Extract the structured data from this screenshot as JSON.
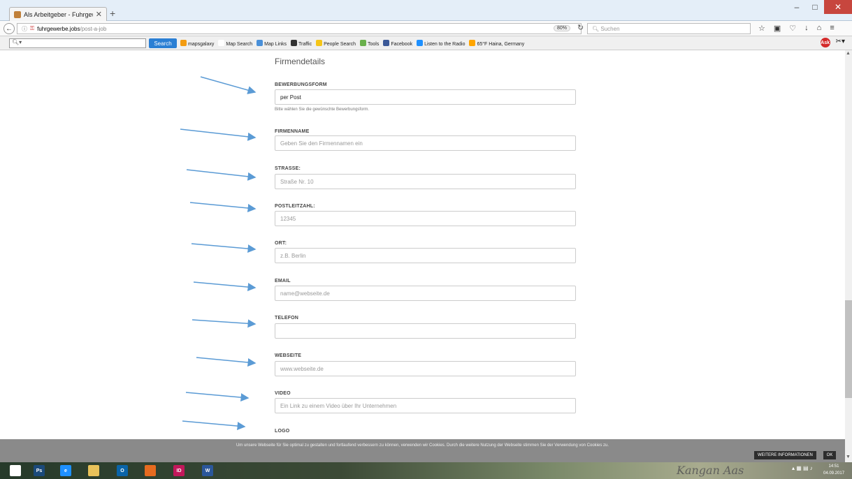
{
  "browser": {
    "tab_title": "Als Arbeitgeber - Fuhrgewer",
    "tab_close": "✕",
    "new_tab": "+",
    "url_host": "fuhrgewerbe.jobs",
    "url_path": "/post-a-job",
    "zoom": "80%",
    "search_placeholder": "Suchen",
    "window_minimize": "–",
    "window_maximize": "□",
    "window_close": "✕"
  },
  "toolbar": {
    "search_button": "Search",
    "items": [
      {
        "label": "mapsgalaxy",
        "color": "#f39c12"
      },
      {
        "label": "Map Search",
        "color": "#ffffff"
      },
      {
        "label": "Map Links",
        "color": "#4a90d9"
      },
      {
        "label": "Traffic",
        "color": "#333333"
      },
      {
        "label": "People Search",
        "color": "#f5c518"
      },
      {
        "label": "Tools",
        "color": "#6ab04c"
      },
      {
        "label": "Facebook",
        "color": "#3b5998"
      },
      {
        "label": "Listen to the Radio",
        "color": "#1e90ff"
      },
      {
        "label": "65°F Haina, Germany",
        "color": "#ffa500"
      }
    ]
  },
  "form": {
    "section_title": "Firmendetails",
    "fields": [
      {
        "label": "BEWERBUNGSFORM",
        "value": "per Post",
        "hint": "Bitte wählen Sie die gewünschte Bewerbungsform."
      },
      {
        "label": "FIRMENNAME",
        "placeholder": "Geben Sie den Firmennamen ein"
      },
      {
        "label": "STRASSE:",
        "placeholder": "Straße Nr. 10"
      },
      {
        "label": "POSTLEITZAHL:",
        "placeholder": "12345"
      },
      {
        "label": "ORT:",
        "placeholder": "z.B. Berlin"
      },
      {
        "label": "EMAIL",
        "placeholder": "name@webseite.de"
      },
      {
        "label": "TELEFON",
        "placeholder": ""
      },
      {
        "label": "WEBSEITE",
        "placeholder": "www.webseite.de"
      },
      {
        "label": "VIDEO",
        "placeholder": "Ein Link zu einem Video über Ihr Unternehmen"
      },
      {
        "label": "LOGO"
      }
    ]
  },
  "cookie": {
    "text": "Um unsere Webseite für Sie optimal zu gestalten und fortlaufend verbessern zu können, verwenden wir Cookies. Durch die weitere Nutzung der Webseite stimmen Sie der Verwendung von Cookies zu.",
    "more_button": "WEITERE INFORMATIONEN",
    "ok_button": "OK"
  },
  "taskbar": {
    "apps": [
      {
        "name": "windows-start",
        "label": "",
        "color": "#ffffff"
      },
      {
        "name": "photoshop",
        "label": "Ps",
        "color": "#1b4a7a"
      },
      {
        "name": "internet-explorer",
        "label": "e",
        "color": "#1e90ff"
      },
      {
        "name": "file-explorer",
        "label": "",
        "color": "#e8c25a"
      },
      {
        "name": "outlook",
        "label": "O",
        "color": "#0a64a8"
      },
      {
        "name": "firefox",
        "label": "",
        "color": "#e66b1f"
      },
      {
        "name": "indesign",
        "label": "ID",
        "color": "#c2185b"
      },
      {
        "name": "word",
        "label": "W",
        "color": "#2b579a"
      }
    ],
    "brand": "Kangan Aas",
    "time": "14:51",
    "date": "04.09.2017"
  }
}
